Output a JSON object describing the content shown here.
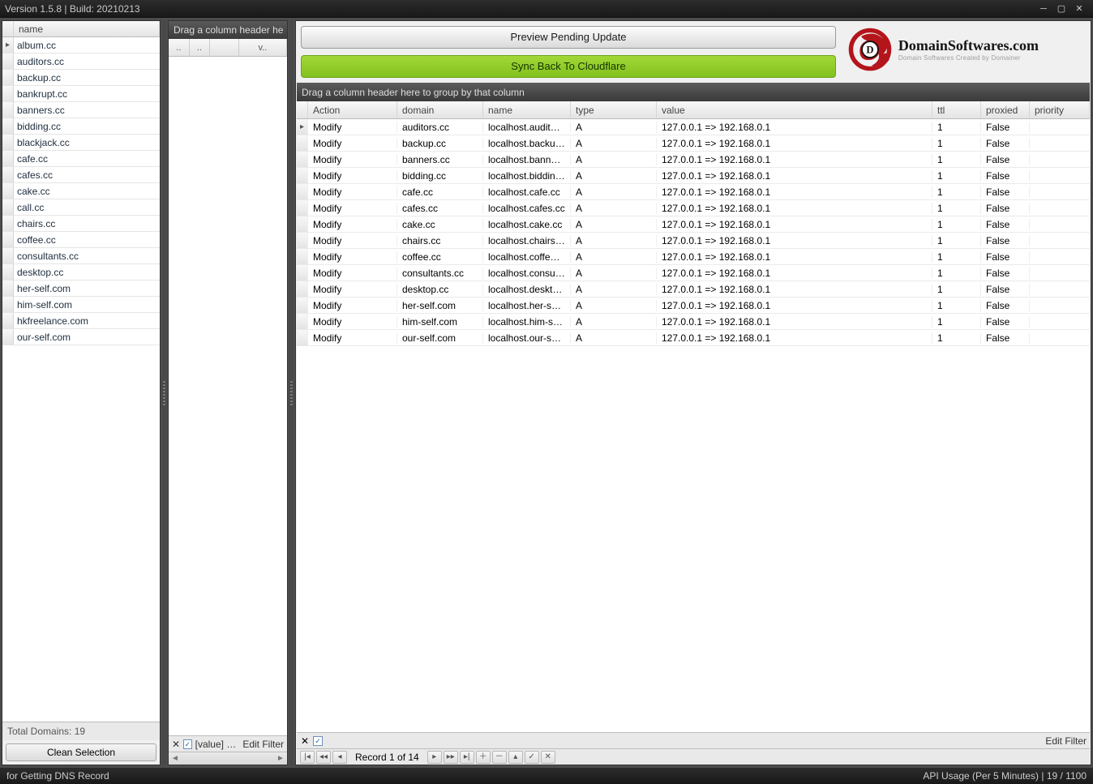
{
  "title": "Version 1.5.8  |  Build: 20210213",
  "sidebar": {
    "header": "name",
    "items": [
      "album.cc",
      "auditors.cc",
      "backup.cc",
      "bankrupt.cc",
      "banners.cc",
      "bidding.cc",
      "blackjack.cc",
      "cafe.cc",
      "cafes.cc",
      "cake.cc",
      "call.cc",
      "chairs.cc",
      "coffee.cc",
      "consultants.cc",
      "desktop.cc",
      "her-self.com",
      "him-self.com",
      "hkfreelance.com",
      "our-self.com"
    ],
    "selected_index": 0,
    "footer": "Total Domains: 19",
    "clean_btn": "Clean Selection"
  },
  "mid": {
    "group_hint": "Drag a column header he",
    "cols": [
      "..",
      "..",
      "",
      "v.."
    ],
    "filter_text": "[value] …",
    "edit_filter": "Edit Filter"
  },
  "right": {
    "preview_btn": "Preview Pending Update",
    "sync_btn": "Sync Back To Cloudflare",
    "brand": {
      "title": "DomainSoftwares.com",
      "sub": "Domain Softwares Created by Domainer"
    },
    "group_hint": "Drag a column header here to group by that column",
    "columns": [
      "Action",
      "domain",
      "name",
      "type",
      "value",
      "ttl",
      "proxied",
      "priority"
    ],
    "rows": [
      {
        "action": "Modify",
        "domain": "auditors.cc",
        "name": "localhost.auditors...",
        "type": "A",
        "value": "127.0.0.1 => 192.168.0.1",
        "ttl": "1",
        "proxied": "False",
        "priority": ""
      },
      {
        "action": "Modify",
        "domain": "backup.cc",
        "name": "localhost.backup.cc",
        "type": "A",
        "value": "127.0.0.1 => 192.168.0.1",
        "ttl": "1",
        "proxied": "False",
        "priority": ""
      },
      {
        "action": "Modify",
        "domain": "banners.cc",
        "name": "localhost.banners...",
        "type": "A",
        "value": "127.0.0.1 => 192.168.0.1",
        "ttl": "1",
        "proxied": "False",
        "priority": ""
      },
      {
        "action": "Modify",
        "domain": "bidding.cc",
        "name": "localhost.bidding.cc",
        "type": "A",
        "value": "127.0.0.1 => 192.168.0.1",
        "ttl": "1",
        "proxied": "False",
        "priority": ""
      },
      {
        "action": "Modify",
        "domain": "cafe.cc",
        "name": "localhost.cafe.cc",
        "type": "A",
        "value": "127.0.0.1 => 192.168.0.1",
        "ttl": "1",
        "proxied": "False",
        "priority": ""
      },
      {
        "action": "Modify",
        "domain": "cafes.cc",
        "name": "localhost.cafes.cc",
        "type": "A",
        "value": "127.0.0.1 => 192.168.0.1",
        "ttl": "1",
        "proxied": "False",
        "priority": ""
      },
      {
        "action": "Modify",
        "domain": "cake.cc",
        "name": "localhost.cake.cc",
        "type": "A",
        "value": "127.0.0.1 => 192.168.0.1",
        "ttl": "1",
        "proxied": "False",
        "priority": ""
      },
      {
        "action": "Modify",
        "domain": "chairs.cc",
        "name": "localhost.chairs.cc",
        "type": "A",
        "value": "127.0.0.1 => 192.168.0.1",
        "ttl": "1",
        "proxied": "False",
        "priority": ""
      },
      {
        "action": "Modify",
        "domain": "coffee.cc",
        "name": "localhost.coffee.cc",
        "type": "A",
        "value": "127.0.0.1 => 192.168.0.1",
        "ttl": "1",
        "proxied": "False",
        "priority": ""
      },
      {
        "action": "Modify",
        "domain": "consultants.cc",
        "name": "localhost.consulta...",
        "type": "A",
        "value": "127.0.0.1 => 192.168.0.1",
        "ttl": "1",
        "proxied": "False",
        "priority": ""
      },
      {
        "action": "Modify",
        "domain": "desktop.cc",
        "name": "localhost.desktop...",
        "type": "A",
        "value": "127.0.0.1 => 192.168.0.1",
        "ttl": "1",
        "proxied": "False",
        "priority": ""
      },
      {
        "action": "Modify",
        "domain": "her-self.com",
        "name": "localhost.her-self....",
        "type": "A",
        "value": "127.0.0.1 => 192.168.0.1",
        "ttl": "1",
        "proxied": "False",
        "priority": ""
      },
      {
        "action": "Modify",
        "domain": "him-self.com",
        "name": "localhost.him-self....",
        "type": "A",
        "value": "127.0.0.1 => 192.168.0.1",
        "ttl": "1",
        "proxied": "False",
        "priority": ""
      },
      {
        "action": "Modify",
        "domain": "our-self.com",
        "name": "localhost.our-self....",
        "type": "A",
        "value": "127.0.0.1 => 192.168.0.1",
        "ttl": "1",
        "proxied": "False",
        "priority": ""
      }
    ],
    "selected_row_index": 0,
    "record_label": "Record 1 of 14",
    "edit_filter": "Edit Filter"
  },
  "status": {
    "left": "for Getting DNS Record",
    "right": "API Usage (Per 5 Minutes) | 19 / 1100"
  }
}
